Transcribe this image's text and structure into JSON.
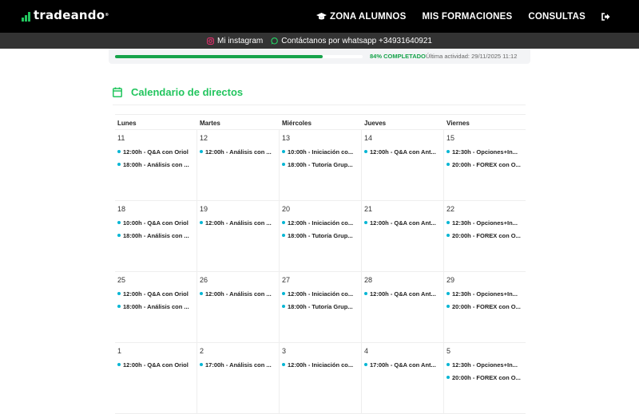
{
  "brand": {
    "name": "tradeando",
    "trademark": "®"
  },
  "nav": {
    "items": [
      {
        "label": "ZONA ALUMNOS",
        "icon": "graduation-cap-icon"
      },
      {
        "label": "MIS FORMACIONES"
      },
      {
        "label": "CONSULTAS"
      }
    ],
    "logout_icon": "sign-out-icon"
  },
  "subbar": {
    "instagram": "Mi instagram",
    "whatsapp": "Contáctanos por whatsapp +34931640921"
  },
  "progress": {
    "percent": 84,
    "label": "84% COMPLETADO",
    "last_activity": "Última actividad: 29/11/2025 11:12"
  },
  "calendar": {
    "title": "Calendario de directos",
    "days": [
      "Lunes",
      "Martes",
      "Miércoles",
      "Jueves",
      "Viernes"
    ],
    "weeks": [
      [
        {
          "date": "11",
          "events": [
            "12:00h - Q&A con Oriol",
            "18:00h - Análisis con ..."
          ]
        },
        {
          "date": "12",
          "events": [
            "12:00h - Análisis con ..."
          ]
        },
        {
          "date": "13",
          "events": [
            "10:00h - Iniciación co...",
            "18:00h - Tutoría Grup..."
          ]
        },
        {
          "date": "14",
          "events": [
            "12:00h - Q&A con Ant..."
          ]
        },
        {
          "date": "15",
          "events": [
            "12:30h - Opciones+In...",
            "20:00h - FOREX con O..."
          ]
        }
      ],
      [
        {
          "date": "18",
          "events": [
            "10:00h - Q&A con Oriol",
            "18:00h - Análisis con ..."
          ]
        },
        {
          "date": "19",
          "events": [
            "12:00h - Análisis con ..."
          ]
        },
        {
          "date": "20",
          "events": [
            "12:00h - Iniciación co...",
            "18:00h - Tutoría Grup..."
          ]
        },
        {
          "date": "21",
          "events": [
            "12:00h - Q&A con Ant..."
          ]
        },
        {
          "date": "22",
          "events": [
            "12:30h - Opciones+In...",
            "20:00h - FOREX con O..."
          ]
        }
      ],
      [
        {
          "date": "25",
          "events": [
            "12:00h - Q&A con Oriol",
            "18:00h - Análisis con ..."
          ]
        },
        {
          "date": "26",
          "events": [
            "12:00h - Análisis con ..."
          ]
        },
        {
          "date": "27",
          "events": [
            "12:00h - Iniciación co...",
            "18:00h - Tutoría Grup..."
          ]
        },
        {
          "date": "28",
          "events": [
            "12:00h - Q&A con Ant..."
          ]
        },
        {
          "date": "29",
          "events": [
            "12:30h - Opciones+In...",
            "20:00h - FOREX con O..."
          ]
        }
      ],
      [
        {
          "date": "1",
          "events": [
            "12:00h - Q&A con Oriol"
          ]
        },
        {
          "date": "2",
          "events": [
            "17:00h - Análisis con ..."
          ]
        },
        {
          "date": "3",
          "events": [
            "12:00h - Iniciación co..."
          ]
        },
        {
          "date": "4",
          "events": [
            "17:00h - Q&A con Ant..."
          ]
        },
        {
          "date": "5",
          "events": [
            "12:30h - Opciones+In...",
            "20:00h - FOREX con O..."
          ]
        }
      ]
    ]
  },
  "colors": {
    "accent_green": "#22c55e",
    "progress_green": "#16a34a",
    "event_dot": "#06b6d4",
    "nav_bg": "#000000",
    "subbar_bg": "#333333"
  }
}
